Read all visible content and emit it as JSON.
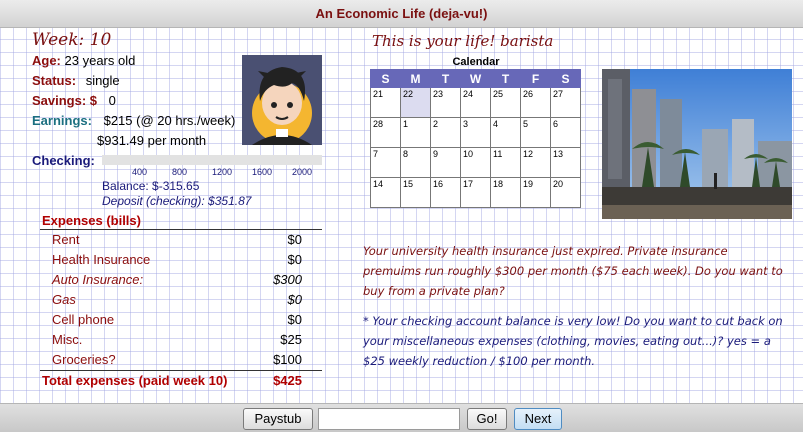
{
  "title": "An Economic Life (deja-vu!)",
  "week": "Week: 10",
  "profile": {
    "age_label": "Age:",
    "age_value": "23 years old",
    "status_label": "Status:",
    "status_value": "single",
    "savings_label": "Savings: $",
    "savings_value": "0",
    "earnings_label": "Earnings:",
    "earnings_value": "$215 (@ 20 hrs./week)",
    "earnings_month": "$931.49 per month"
  },
  "checking": {
    "label": "Checking:",
    "ticks": [
      "400",
      "800",
      "1200",
      "1600",
      "2000"
    ],
    "balance": "Balance: $-315.65",
    "deposit": "Deposit (checking): $351.87"
  },
  "expenses": {
    "title": "Expenses (bills)",
    "rows": [
      {
        "name": "Rent",
        "value": "$0"
      },
      {
        "name": "Health Insurance",
        "value": "$0"
      },
      {
        "name": "Auto Insurance:",
        "value": "$300"
      },
      {
        "name": "Gas",
        "value": "$0"
      },
      {
        "name": "Cell phone",
        "value": "$0"
      },
      {
        "name": "Misc.",
        "value": "$25"
      },
      {
        "name": "Groceries?",
        "value": "$100"
      }
    ],
    "total_label": "Total expenses (paid week 10)",
    "total_value": "$425"
  },
  "life_heading": "This is your life! barista",
  "calendar": {
    "title": "Calendar",
    "days": [
      "S",
      "M",
      "T",
      "W",
      "T",
      "F",
      "S"
    ],
    "weeks": [
      [
        "21",
        "22",
        "23",
        "24",
        "25",
        "26",
        "27"
      ],
      [
        "28",
        "1",
        "2",
        "3",
        "4",
        "5",
        "6"
      ],
      [
        "7",
        "8",
        "9",
        "10",
        "11",
        "12",
        "13"
      ],
      [
        "14",
        "15",
        "16",
        "17",
        "18",
        "19",
        "20"
      ]
    ],
    "today": "22"
  },
  "messages": {
    "insurance": "Your university health insurance just expired. Private insurance premuims run roughly $300 per month ($75 each week). Do you want to buy from a private plan?",
    "checking_low": "* Your checking account balance is very low! Do you want to cut back on your miscellaneous expenses (clothing, movies, eating out...)? yes = a $25 weekly reduction / $100 per month."
  },
  "controls": {
    "paystub": "Paystub",
    "go": "Go!",
    "next": "Next",
    "input_value": ""
  },
  "colors": {
    "accent": "#7a1010",
    "calendar_header": "#6768b8",
    "earnings": "#1b6f80",
    "navy_text": "#1a1a7a"
  }
}
